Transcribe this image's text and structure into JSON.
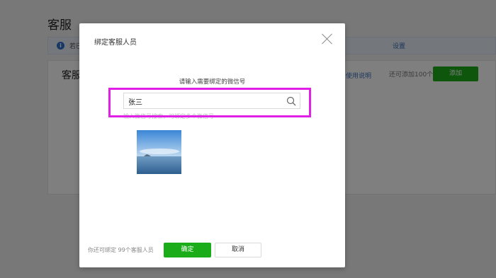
{
  "background": {
    "page_title": "客服",
    "notice_left": "若已",
    "notice_right": "设置",
    "card_title": "客服",
    "usage_link": "使用说明",
    "remain_text": "还可添加100个",
    "add_button": "添加"
  },
  "modal": {
    "title": "绑定客服人员",
    "prompt": "请输入需要绑定的微信号",
    "search": {
      "value": "张三",
      "placeholder": ""
    },
    "hint": "输入微信号搜索，可绑定多个微信号",
    "footer_text": "你还可绑定 99个客服人员",
    "confirm_label": "确定",
    "cancel_label": "取消"
  },
  "colors": {
    "primary_green": "#1aad19",
    "highlight_magenta": "#e020e6",
    "link_blue": "#3a6fb9"
  },
  "icons": {
    "close": "close-icon",
    "search": "search-icon",
    "info": "info-icon"
  }
}
